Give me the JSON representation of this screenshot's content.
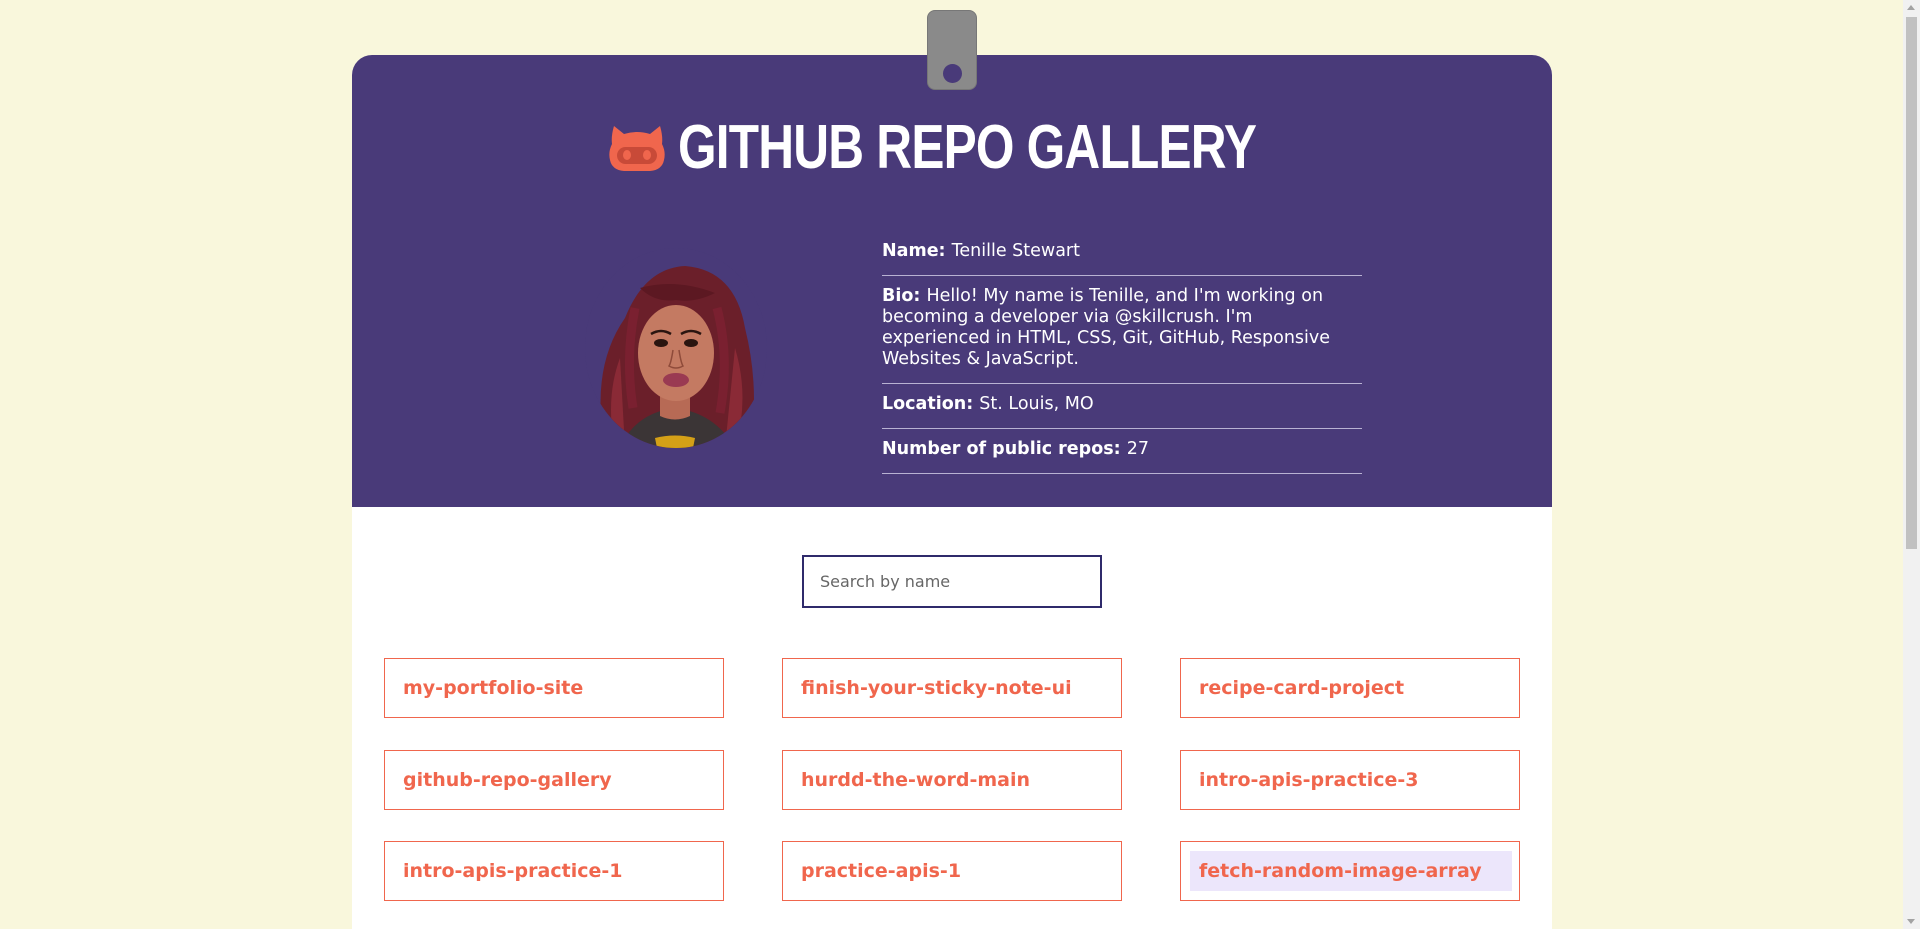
{
  "app": {
    "title": "GITHUB REPO GALLERY"
  },
  "profile": {
    "name_label": "Name:",
    "name_value": "Tenille Stewart",
    "bio_label": "Bio:",
    "bio_value": "Hello! My name is Tenille, and I'm working on becoming a developer via @skillcrush. I'm experienced in HTML, CSS, Git, GitHub, Responsive Websites & JavaScript.",
    "location_label": "Location:",
    "location_value": "St. Louis, MO",
    "repos_label": "Number of public repos:",
    "repos_value": "27"
  },
  "search": {
    "placeholder": "Search by name",
    "value": ""
  },
  "repos": [
    "my-portfolio-site",
    "finish-your-sticky-note-ui",
    "recipe-card-project",
    "github-repo-gallery",
    "hurdd-the-word-main",
    "intro-apis-practice-3",
    "intro-apis-practice-1",
    "practice-apis-1",
    "fetch-random-image-array"
  ],
  "colors": {
    "background": "#f9f7dc",
    "header": "#493a79",
    "accent": "#f0664d",
    "highlight": "#ece6fb"
  },
  "icons": {
    "logo": "github-octocat-icon",
    "clip": "badge-clip-icon"
  }
}
